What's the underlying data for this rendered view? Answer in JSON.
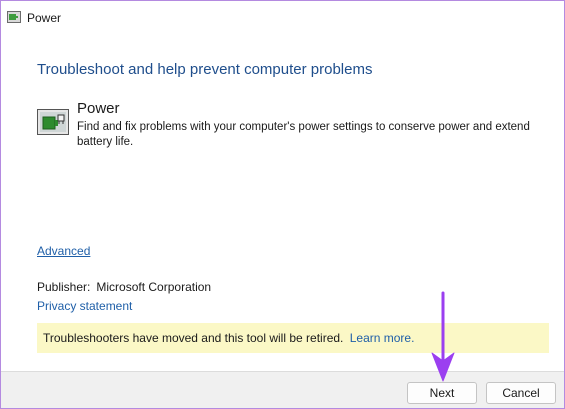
{
  "window": {
    "title": "Power",
    "title_icon": "power-troubleshooter-icon"
  },
  "main": {
    "heading": "Troubleshoot and help prevent computer problems",
    "tool_name": "Power",
    "tool_description": "Find and fix problems with your computer's power settings to conserve power and extend battery life.",
    "tool_icon": "battery-plug-icon",
    "advanced_label": "Advanced",
    "publisher_label": "Publisher:",
    "publisher_value": "Microsoft Corporation",
    "privacy_label": "Privacy statement"
  },
  "notice": {
    "text": "Troubleshooters have moved and this tool will be retired.",
    "link_label": "Learn more.",
    "background": "#fbf8c6"
  },
  "footer": {
    "next_label": "Next",
    "cancel_label": "Cancel"
  },
  "annotation": {
    "arrow_icon": "arrow-down-icon",
    "color": "#9b3ff0"
  },
  "colors": {
    "heading": "#1f4e8c",
    "link": "#1f5fa8",
    "window_border": "#b48ae0"
  }
}
